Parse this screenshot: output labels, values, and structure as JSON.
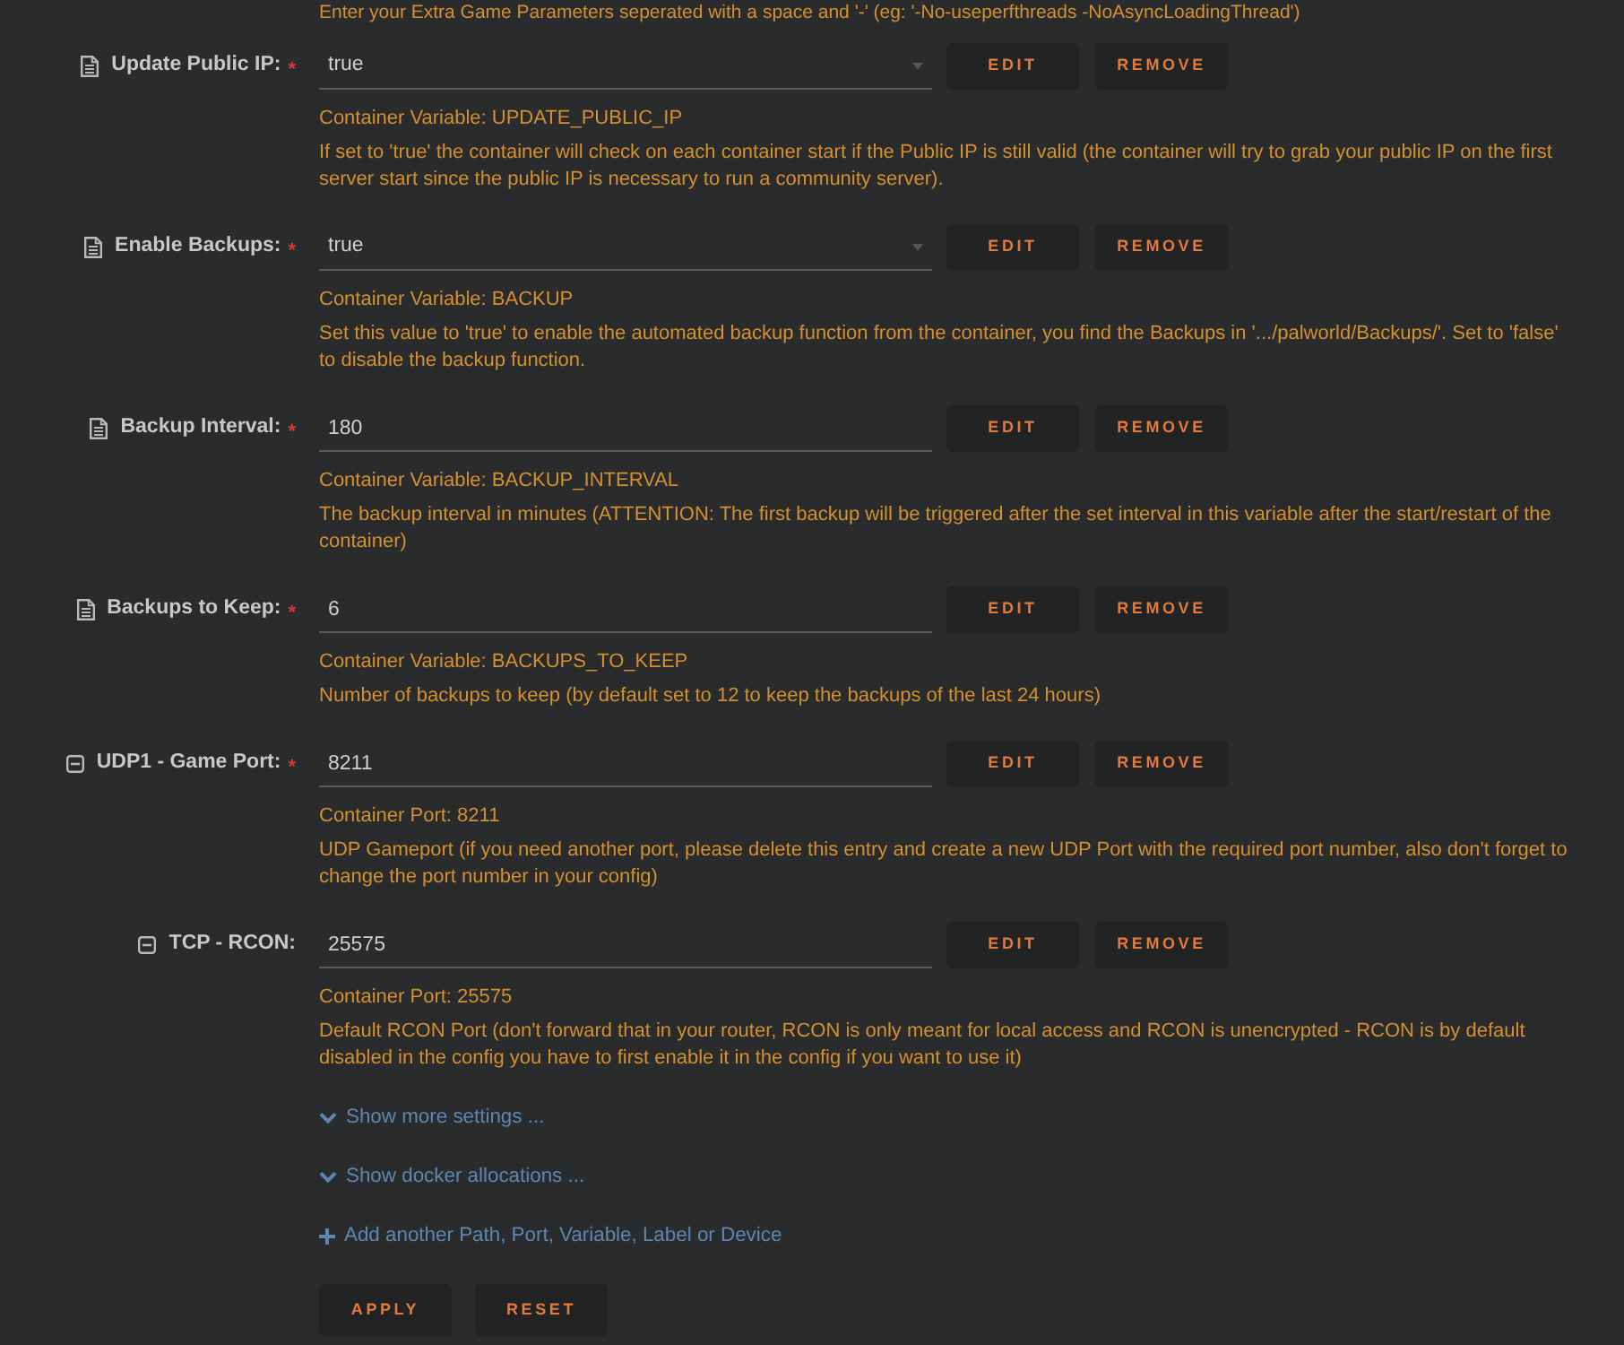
{
  "top_note": "Enter your Extra Game Parameters seperated with a space and '-' (eg: '-No-useperfthreads -NoAsyncLoadingThread')",
  "settings": [
    {
      "kind": "variable",
      "label": "Update Public IP:",
      "required_mark": "*",
      "dropdown": true,
      "value": "true",
      "buttons": [
        "EDIT",
        "REMOVE"
      ],
      "target": "Container Variable: UPDATE_PUBLIC_IP",
      "description": "If set to 'true' the container will check on each container start if the Public IP is still valid (the container will try to grab your public IP on the first server start since the public IP is necessary to run a community server)."
    },
    {
      "kind": "variable",
      "label": "Enable Backups:",
      "required_mark": "*",
      "dropdown": true,
      "value": "true",
      "buttons": [
        "EDIT",
        "REMOVE"
      ],
      "target": "Container Variable: BACKUP",
      "description": "Set this value to 'true' to enable the automated backup function from the container, you find the Backups in '.../palworld/Backups/'. Set to 'false' to disable the backup function."
    },
    {
      "kind": "variable",
      "label": "Backup Interval:",
      "required_mark": "*",
      "dropdown": false,
      "value": "180",
      "buttons": [
        "EDIT",
        "REMOVE"
      ],
      "target": "Container Variable: BACKUP_INTERVAL",
      "description": "The backup interval in minutes (ATTENTION: The first backup will be triggered after the set interval in this variable after the start/restart of the container)"
    },
    {
      "kind": "variable",
      "label": "Backups to Keep:",
      "required_mark": "*",
      "dropdown": false,
      "value": "6",
      "buttons": [
        "EDIT",
        "REMOVE"
      ],
      "target": "Container Variable: BACKUPS_TO_KEEP",
      "description": "Number of backups to keep (by default set to 12 to keep the backups of the last 24 hours)"
    },
    {
      "kind": "port",
      "label": "UDP1 - Game Port:",
      "required_mark": "*",
      "dropdown": false,
      "value": "8211",
      "buttons": [
        "EDIT",
        "REMOVE"
      ],
      "target": "Container Port: 8211",
      "description": "UDP Gameport (if you need another port, please delete this entry and create a new UDP Port with the required port number, also don't forget to change the port number in your config)"
    },
    {
      "kind": "port",
      "label": "TCP - RCON:",
      "dropdown": false,
      "value": "25575",
      "buttons": [
        "EDIT",
        "REMOVE"
      ],
      "target": "Container Port: 25575",
      "description": "Default RCON Port (don't forward that in your router, RCON is only meant for local access and RCON is unencrypted - RCON is by default disabled in the config you have to first enable it in the config if you want to use it)"
    }
  ],
  "links": [
    {
      "kind": "expand",
      "label": "Show more settings ..."
    },
    {
      "kind": "expand",
      "label": "Show docker allocations ..."
    },
    {
      "kind": "add",
      "label": "Add another Path, Port, Variable, Label or Device"
    }
  ],
  "buttons": [
    "APPLY",
    "RESET"
  ]
}
